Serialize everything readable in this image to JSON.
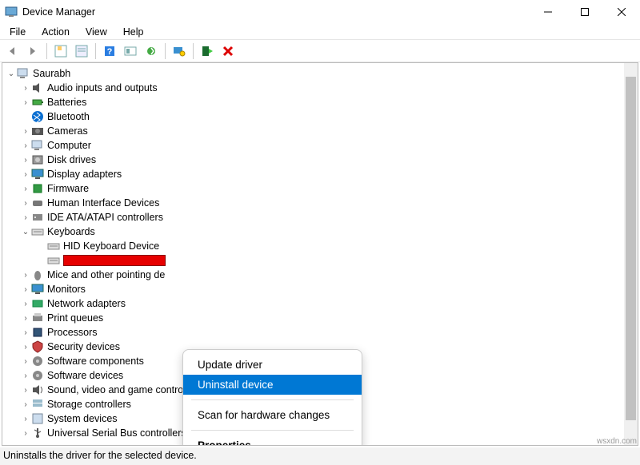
{
  "window": {
    "title": "Device Manager"
  },
  "menubar": [
    "File",
    "Action",
    "View",
    "Help"
  ],
  "tree": {
    "root": "Saurabh",
    "categories": [
      {
        "label": "Audio inputs and outputs",
        "expandable": true
      },
      {
        "label": "Batteries",
        "expandable": true
      },
      {
        "label": "Bluetooth",
        "expandable": false
      },
      {
        "label": "Cameras",
        "expandable": true
      },
      {
        "label": "Computer",
        "expandable": true
      },
      {
        "label": "Disk drives",
        "expandable": true
      },
      {
        "label": "Display adapters",
        "expandable": true
      },
      {
        "label": "Firmware",
        "expandable": true
      },
      {
        "label": "Human Interface Devices",
        "expandable": true
      },
      {
        "label": "IDE ATA/ATAPI controllers",
        "expandable": true
      },
      {
        "label": "Keyboards",
        "expanded": true,
        "children": [
          {
            "label": "HID Keyboard Device"
          },
          {
            "label": "",
            "redacted": true
          }
        ]
      },
      {
        "label": "Mice and other pointing de",
        "expandable": true
      },
      {
        "label": "Monitors",
        "expandable": true
      },
      {
        "label": "Network adapters",
        "expandable": true
      },
      {
        "label": "Print queues",
        "expandable": true
      },
      {
        "label": "Processors",
        "expandable": true
      },
      {
        "label": "Security devices",
        "expandable": true
      },
      {
        "label": "Software components",
        "expandable": true
      },
      {
        "label": "Software devices",
        "expandable": true
      },
      {
        "label": "Sound, video and game controllers",
        "expandable": true
      },
      {
        "label": "Storage controllers",
        "expandable": true
      },
      {
        "label": "System devices",
        "expandable": true
      },
      {
        "label": "Universal Serial Bus controllers",
        "expandable": true
      }
    ]
  },
  "context_menu": {
    "items": [
      {
        "label": "Update driver"
      },
      {
        "label": "Uninstall device",
        "selected": true
      },
      {
        "sep": true
      },
      {
        "label": "Scan for hardware changes"
      },
      {
        "sep": true
      },
      {
        "label": "Properties",
        "bold": true
      }
    ]
  },
  "statusbar": "Uninstalls the driver for the selected device.",
  "watermark": "wsxdn.com"
}
